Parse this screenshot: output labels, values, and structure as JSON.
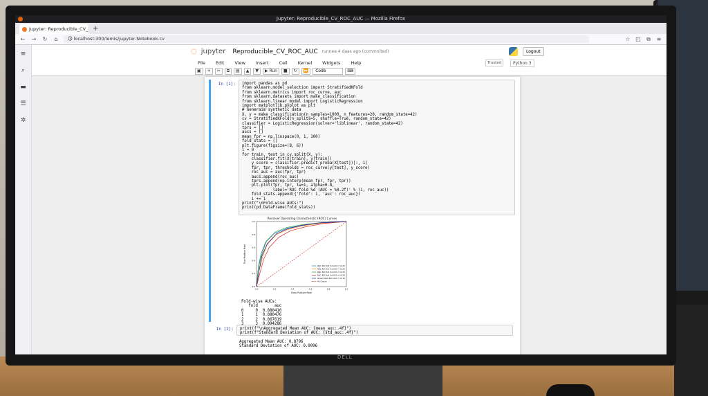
{
  "window": {
    "title": "Jupyter: Reproducible_CV_ROC_AUC — Mozilla Firefox"
  },
  "tab": {
    "label": "Jupyter: Reproducible_CV_R",
    "close": "×",
    "new": "+"
  },
  "address": {
    "url": "localhost:300/lemis/jupyter-Notebook.cv"
  },
  "jupyter": {
    "logo_text": "jupyter",
    "notebook_title": "Reproducible_CV_ROC_AUC",
    "checkpoint": "runnea 4 daas ago (commnited)",
    "logout_label": "Logout",
    "trusted_label": "Trusted",
    "kernel_label": "Python 3",
    "menus": [
      "File",
      "Edit",
      "View",
      "Insert",
      "Cell",
      "Kernel",
      "Widgets",
      "Help"
    ],
    "toolbar": {
      "run_label": "Run",
      "cell_type": "Code"
    }
  },
  "cell1": {
    "prompt": "In [1]:",
    "lines": [
      "import pandas as pd",
      "from sklearn.model_selection import StratifiedKFold",
      "from sklearn.metrics import roc_curve, auc",
      "from sklearn.datasets import make_classification",
      "from sklearn.linear_model import LogisticRegression",
      "import matplotlib.pyplot as plt",
      "",
      "# Generaim synthetic data",
      "X, y = make_classification(n_samples=1000, n_features=20, random_state=42)",
      "cv = StratifiedKFold(n_splits=5, shuffle=True, random_state=42)",
      "classifier = LogisticRegression(solver='liblinear', random_state=42)",
      "",
      "tprs = []",
      "aucs = []",
      "mean_fpr = np.linspace(0, 1, 100)",
      "fold_stats = []",
      "",
      "plt.figure(figsize=(8, 6))",
      "i = 0",
      "for train, test in cv.split(X, y):",
      "    classifier.fit(X[train], y[train])",
      "    y_score = classifier.predict_proba(X[test])[:, 1]",
      "    fpr, tpr, thresholds = roc_curve(y[test], y_score)",
      "    roc_auc = auc(fpr, tpr)",
      "    aucs.append(roc_auc)",
      "    tprs.append(np.interp(mean_fpr, fpr, tpr))",
      "    plt.plot(fpr, tpr, lw=1, alpha=0.8,",
      "             label='ROC fold %d (AUC = %0.2f)' % (i, roc_auc))",
      "    fold_stats.append({'fold': i, 'auc': roc_auc})",
      "    i += 1",
      "print(\"\\nFold-wise AUCs:\")",
      "print(pd.DataFrame(fold_stats))"
    ],
    "output_lines": [
      "Fold-wise AUCs:",
      "   fold       auc",
      "0     0  0.880410",
      "1     1  0.880476",
      "2     2  0.867619",
      "3     3  0.894286",
      "4     4  0.871905"
    ]
  },
  "cell2": {
    "prompt": "In [2]:",
    "lines": [
      "print(f\"\\nAggregated Mean AUC: {mean_auc:.4f}\")",
      "print(f\"Standard Deviation of AUC: {std_auc:.4f}\")"
    ],
    "output_lines": [
      "Aggregated Mean AUC: 0.8796",
      "Standard Deviation of AUC: 0.0096"
    ]
  },
  "chart_data": {
    "type": "line",
    "title": "Receiver Operating Characteristic (ROC) Curves",
    "xlabel": "False Positive Rate",
    "ylabel": "True Positive Rate",
    "xlim": [
      0,
      1
    ],
    "ylim": [
      0,
      1
    ],
    "x_ticks": [
      "0.0",
      "0.2",
      "0.4",
      "0.6",
      "0.8",
      "1.0"
    ],
    "y_ticks": [
      "0.0",
      "0.2",
      "0.4",
      "0.6",
      "0.8",
      "1.0"
    ],
    "legend_position": "lower right",
    "series": [
      {
        "name": "ROC, ROC fold %d (AUC = %0.2f)",
        "color": "#1f77b4",
        "x": [
          0,
          0.02,
          0.05,
          0.1,
          0.2,
          0.35,
          0.5,
          0.7,
          1.0
        ],
        "y": [
          0,
          0.3,
          0.5,
          0.68,
          0.82,
          0.9,
          0.94,
          0.98,
          1.0
        ]
      },
      {
        "name": "ROC, ROC fold %d (AUC = %0.2f)",
        "color": "#ff7f0e",
        "x": [
          0,
          0.03,
          0.07,
          0.12,
          0.22,
          0.35,
          0.5,
          0.7,
          1.0
        ],
        "y": [
          0,
          0.25,
          0.47,
          0.65,
          0.8,
          0.88,
          0.93,
          0.97,
          1.0
        ]
      },
      {
        "name": "ROC, ROC fold %d (AUC = %0.2f)",
        "color": "#2ca02c",
        "x": [
          0,
          0.02,
          0.06,
          0.11,
          0.21,
          0.34,
          0.5,
          0.7,
          1.0
        ],
        "y": [
          0,
          0.28,
          0.5,
          0.7,
          0.84,
          0.91,
          0.95,
          0.98,
          1.0
        ]
      },
      {
        "name": "ROC, ROC fold %d (AUC = %0.2f)",
        "color": "#d62728",
        "x": [
          0,
          0.04,
          0.08,
          0.14,
          0.25,
          0.38,
          0.55,
          0.75,
          1.0
        ],
        "y": [
          0,
          0.22,
          0.42,
          0.6,
          0.76,
          0.86,
          0.92,
          0.97,
          1.0
        ]
      },
      {
        "name": "Stream Mean ROC (AUC = %0.2f)",
        "color": "#1a1aa0",
        "x": [
          0,
          0.03,
          0.06,
          0.12,
          0.22,
          0.35,
          0.5,
          0.7,
          1.0
        ],
        "y": [
          0,
          0.26,
          0.47,
          0.66,
          0.81,
          0.89,
          0.94,
          0.98,
          1.0
        ]
      },
      {
        "name": "4% Chance",
        "color": "#d62728",
        "dashed": true,
        "x": [
          0,
          1
        ],
        "y": [
          0,
          1
        ]
      }
    ]
  }
}
